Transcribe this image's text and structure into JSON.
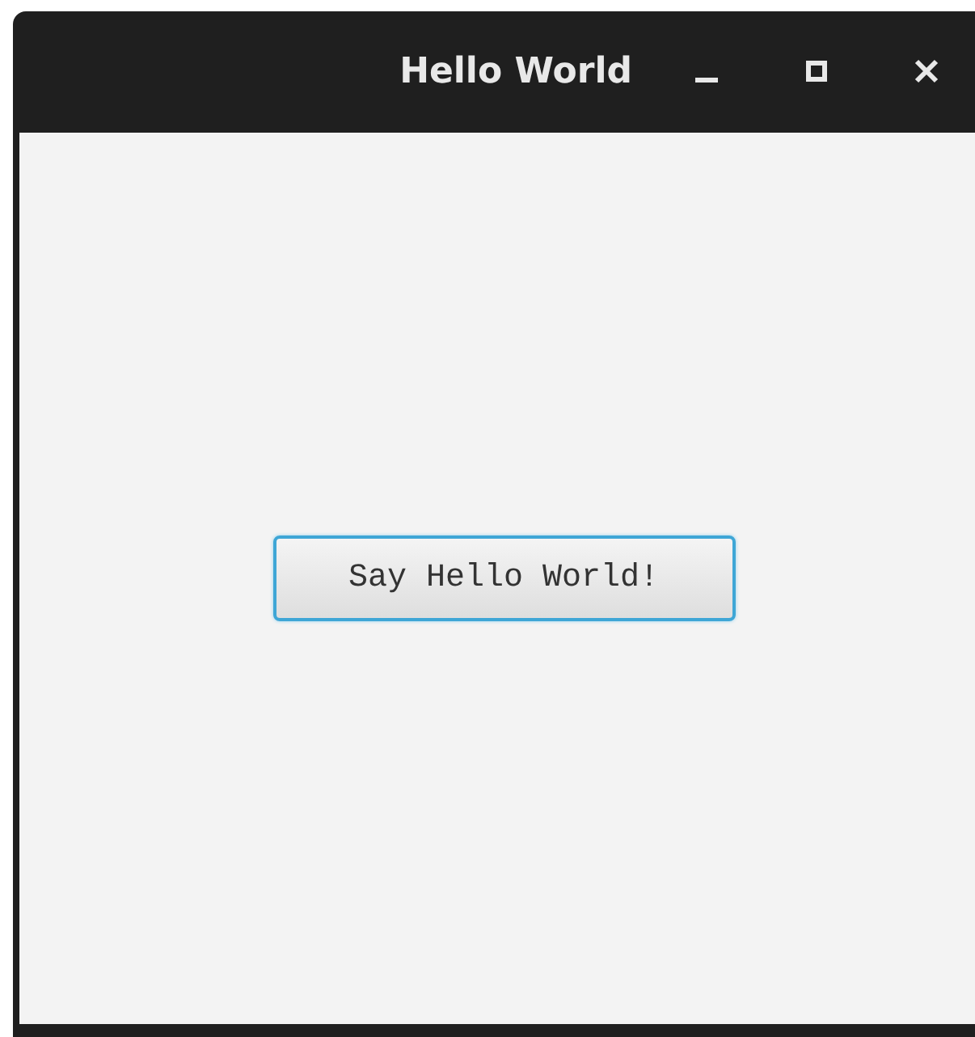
{
  "window": {
    "title": "Hello World"
  },
  "button": {
    "label": "Say Hello World!",
    "focused": true
  }
}
